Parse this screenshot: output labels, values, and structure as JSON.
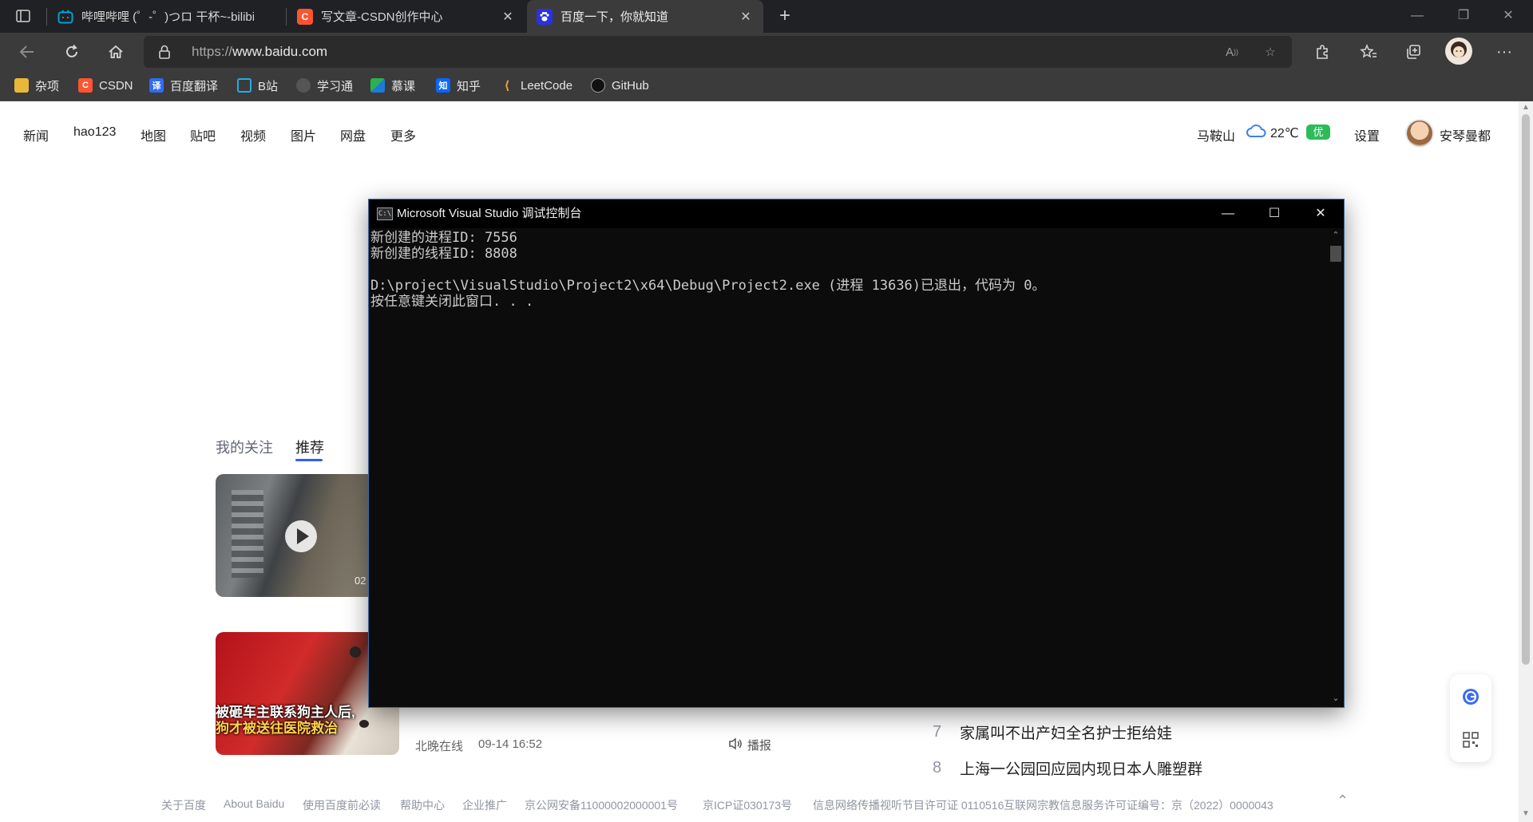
{
  "browser": {
    "tabs": [
      {
        "title": "哔哩哔哩 (゜-゜)つロ 干杯~-bilibili",
        "icon": "bilibili-icon",
        "color": "#00a1d6"
      },
      {
        "title": "写文章-CSDN创作中心",
        "icon": "csdn-icon",
        "color": "#fc5531"
      },
      {
        "title": "百度一下，你就知道",
        "icon": "baidu-icon",
        "color": "#2932e1"
      }
    ],
    "url_prefix": "https://",
    "url_host": "www.baidu.com",
    "bookmarks": [
      "杂项",
      "CSDN",
      "百度翻译",
      "B站",
      "学习通",
      "慕课",
      "知乎",
      "LeetCode",
      "GitHub"
    ]
  },
  "baidu": {
    "nav": [
      "新闻",
      "hao123",
      "地图",
      "贴吧",
      "视频",
      "图片",
      "网盘",
      "更多"
    ],
    "weather": {
      "city": "马鞍山",
      "temp": "22℃",
      "aqi": "优"
    },
    "settings": "设置",
    "username": "安琴曼都",
    "feed_tabs": {
      "following": "我的关注",
      "recommend": "推荐"
    },
    "video_duration": "02",
    "thumb2_caption_line1": "被砸车主联系狗主人后,",
    "thumb2_caption_line2": "狗才被送往医院救治",
    "news_meta": {
      "source": "北晚在线",
      "time": "09-14 16:52",
      "report": "播报"
    },
    "hot_list": [
      {
        "rank": "7",
        "title": "家属叫不出产妇全名护士拒给娃"
      },
      {
        "rank": "8",
        "title": "上海一公园回应园内现日本人雕塑群"
      }
    ],
    "footer": [
      "关于百度",
      "About Baidu",
      "使用百度前必读",
      "帮助中心",
      "企业推广",
      "京公网安备11000002000001号",
      "京ICP证030173号",
      "信息网络传播视听节目许可证 0110516",
      "互联网宗教信息服务许可证编号：京（2022）0000043"
    ]
  },
  "console": {
    "title": "Microsoft Visual Studio 调试控制台",
    "icon_label": "C:\\",
    "lines": [
      "新创建的进程ID: 7556",
      "新创建的线程ID: 8808",
      "",
      "D:\\project\\VisualStudio\\Project2\\x64\\Debug\\Project2.exe (进程 13636)已退出，代码为 0。",
      "按任意键关闭此窗口. . ."
    ]
  }
}
